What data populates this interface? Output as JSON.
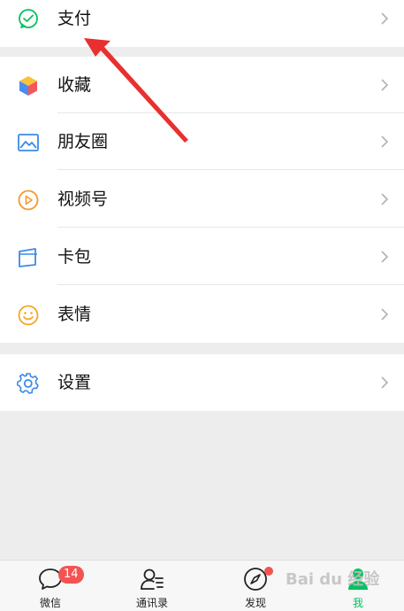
{
  "colors": {
    "accent_green": "#07c160",
    "arrow_red": "#e8302f",
    "badge_red": "#f25454",
    "chevron": "#b2b2b2"
  },
  "menu": {
    "pay": {
      "label": "支付",
      "icon": "wechat-pay-icon"
    },
    "favorites": {
      "label": "收藏",
      "icon": "favorites-cube-icon"
    },
    "moments": {
      "label": "朋友圈",
      "icon": "moments-image-icon"
    },
    "channels": {
      "label": "视频号",
      "icon": "channels-play-icon"
    },
    "cards": {
      "label": "卡包",
      "icon": "card-wallet-icon"
    },
    "stickers": {
      "label": "表情",
      "icon": "sticker-smile-icon"
    },
    "settings": {
      "label": "设置",
      "icon": "gear-icon"
    }
  },
  "tabbar": {
    "chats": {
      "label": "微信",
      "badge": "14"
    },
    "contacts": {
      "label": "通讯录"
    },
    "discover": {
      "label": "发现"
    },
    "me": {
      "label": "我"
    }
  },
  "watermark": {
    "text": "Bai du 经验"
  }
}
